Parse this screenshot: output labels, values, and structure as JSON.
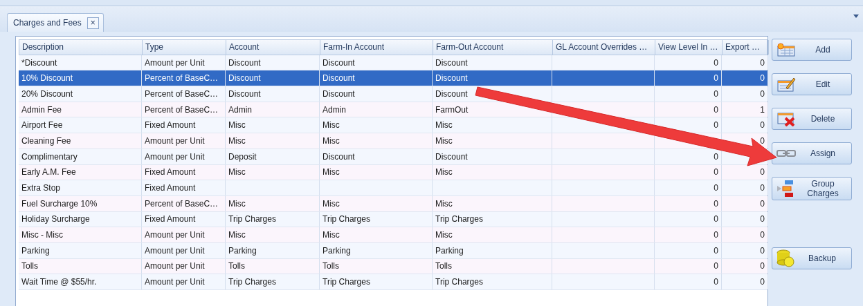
{
  "tab": {
    "label": "Charges and Fees",
    "close": "×"
  },
  "table": {
    "columns": [
      "Description",
      "Type",
      "Account",
      "Farm-In Account",
      "Farm-Out Account",
      "GL Account Overrides …",
      "View Level In …",
      "Export …"
    ],
    "rows": [
      {
        "selected": false,
        "cells": [
          "*Discount",
          "Amount per Unit",
          "Discount",
          "Discount",
          "Discount",
          "",
          "0",
          "0"
        ]
      },
      {
        "selected": true,
        "cells": [
          "10% Discount",
          "Percent of BaseC…",
          "Discount",
          "Discount",
          "Discount",
          "",
          "0",
          "0"
        ]
      },
      {
        "selected": false,
        "cells": [
          "20% Discount",
          "Percent of BaseC…",
          "Discount",
          "Discount",
          "Discount",
          "",
          "0",
          "0"
        ]
      },
      {
        "selected": false,
        "cells": [
          "Admin Fee",
          "Percent of BaseC…",
          "Admin",
          "Admin",
          "FarmOut",
          "",
          "0",
          "1"
        ]
      },
      {
        "selected": false,
        "cells": [
          "Airport Fee",
          "Fixed Amount",
          "Misc",
          "Misc",
          "Misc",
          "",
          "0",
          "0"
        ]
      },
      {
        "selected": false,
        "cells": [
          "Cleaning Fee",
          "Amount per Unit",
          "Misc",
          "Misc",
          "Misc",
          "",
          "",
          "0"
        ]
      },
      {
        "selected": false,
        "cells": [
          "Complimentary",
          "Amount per Unit",
          "Deposit",
          "Discount",
          "Discount",
          "",
          "0",
          ""
        ]
      },
      {
        "selected": false,
        "cells": [
          "Early A.M. Fee",
          "Fixed Amount",
          "Misc",
          "Misc",
          "Misc",
          "",
          "0",
          "0"
        ]
      },
      {
        "selected": false,
        "cells": [
          "Extra Stop",
          "Fixed Amount",
          "",
          "",
          "",
          "",
          "0",
          "0"
        ]
      },
      {
        "selected": false,
        "cells": [
          "Fuel Surcharge 10%",
          "Percent of BaseC…",
          "Misc",
          "Misc",
          "Misc",
          "",
          "0",
          "0"
        ]
      },
      {
        "selected": false,
        "cells": [
          "Holiday Surcharge",
          "Fixed Amount",
          "Trip Charges",
          "Trip Charges",
          "Trip Charges",
          "",
          "0",
          "0"
        ]
      },
      {
        "selected": false,
        "cells": [
          "Misc - Misc",
          "Amount per Unit",
          "Misc",
          "Misc",
          "Misc",
          "",
          "0",
          "0"
        ]
      },
      {
        "selected": false,
        "cells": [
          "Parking",
          "Amount per Unit",
          "Parking",
          "Parking",
          "Parking",
          "",
          "0",
          "0"
        ]
      },
      {
        "selected": false,
        "cells": [
          "Tolls",
          "Amount per Unit",
          "Tolls",
          "Tolls",
          "Tolls",
          "",
          "0",
          "0"
        ]
      },
      {
        "selected": false,
        "cells": [
          "Wait Time @ $55/hr.",
          "Amount per Unit",
          "Trip Charges",
          "Trip Charges",
          "Trip Charges",
          "",
          "0",
          "0"
        ]
      }
    ]
  },
  "buttons": [
    {
      "kind": "add",
      "lines": [
        "Add"
      ]
    },
    {
      "kind": "edit",
      "lines": [
        "Edit"
      ]
    },
    {
      "kind": "delete",
      "lines": [
        "Delete"
      ]
    },
    {
      "kind": "assign",
      "lines": [
        "Assign"
      ]
    },
    {
      "kind": "group",
      "lines": [
        "Group",
        "Charges"
      ]
    },
    {
      "kind": "backup",
      "lines": [
        "Backup"
      ]
    }
  ]
}
